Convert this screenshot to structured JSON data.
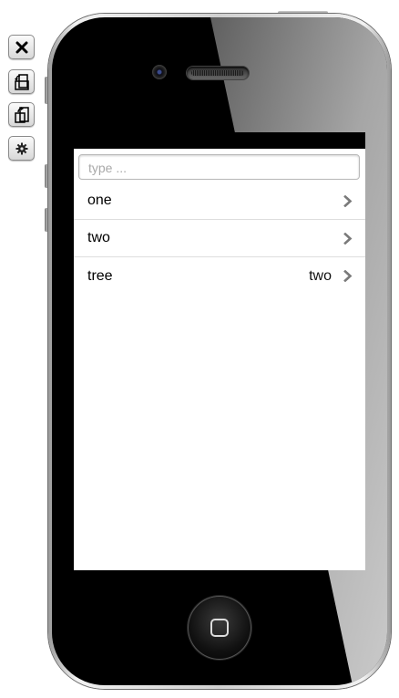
{
  "toolbar": {
    "close_icon": "close-icon",
    "rotate_left_icon": "rotate-left-icon",
    "rotate_right_icon": "rotate-right-icon",
    "settings_icon": "gear-icon"
  },
  "search": {
    "placeholder": "type ...",
    "value": ""
  },
  "list": {
    "items": [
      {
        "label": "one",
        "detail": ""
      },
      {
        "label": "two",
        "detail": ""
      },
      {
        "label": "tree",
        "detail": "two"
      }
    ]
  },
  "colors": {
    "phone_body": "#000000",
    "screen_bg": "#ffffff",
    "separator": "#dedede",
    "chevron": "#7a7a7a"
  }
}
